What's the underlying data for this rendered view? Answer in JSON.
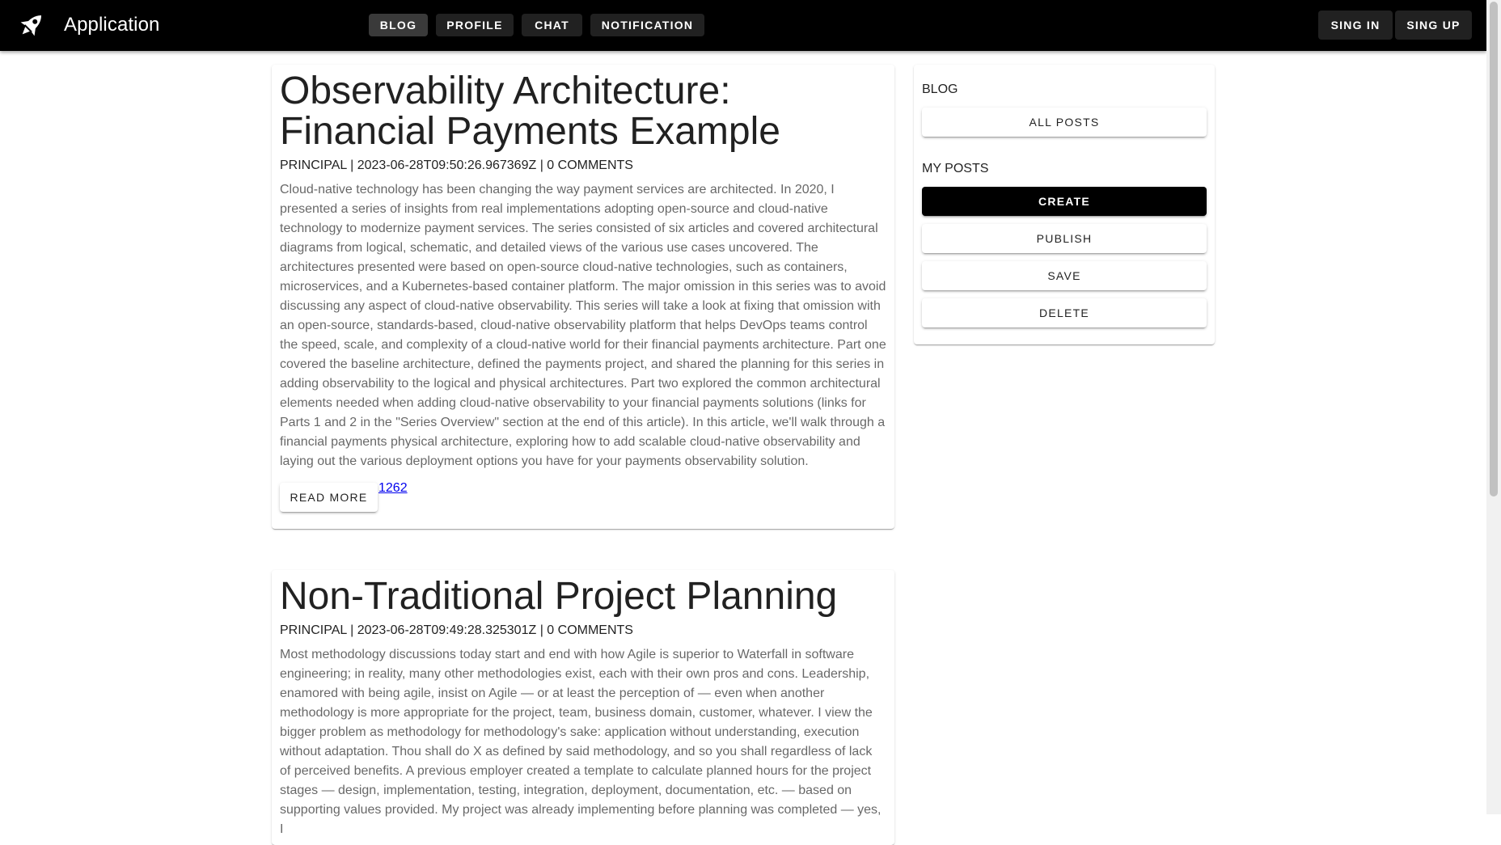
{
  "app": {
    "title": "Application"
  },
  "nav": {
    "items": [
      {
        "label": "BLOG",
        "active": true
      },
      {
        "label": "PROFILE",
        "active": false
      },
      {
        "label": "CHAT",
        "active": false
      },
      {
        "label": "NOTIFICATION",
        "active": false
      }
    ],
    "sign_in": "SING IN",
    "sign_up": "SING UP"
  },
  "posts": [
    {
      "title": "Observability Architecture: Financial Payments Example",
      "meta": "PRINCIPAL | 2023-06-28T09:50:26.967369Z | 0 COMMENTS",
      "body": "Cloud-native technology has been changing the way payment services are architected. In 2020, I presented a series of insights from real implementations adopting open-source and cloud-native technology to modernize payment services. The series consisted of six articles and covered architectural diagrams from logical, schematic, and detailed views of the various use cases uncovered. The architectures presented were based on open-source cloud-native technologies, such as containers, microservices, and a Kubernetes-based container platform. The major omission in this series was to avoid discussing any aspect of cloud-native observability. This series will take a look at fixing that omission with an open-source, standards-based, cloud-native observability platform that helps DevOps teams control the speed, scale, and complexity of a cloud-native world for their financial payments architecture. Part one covered the baseline architecture, defined the payments project, and shared the planning for this series in adding observability to the logical and physical architectures. Part two explored the common architectural elements needed when adding cloud-native observability to your financial payments solutions (links for Parts 1 and 2 in the \"Series Overview\" section at the end of this article). In this article, we'll walk through a financial payments physical architecture, exploring how to add scalable cloud-native observability and laying out the various deployment options you have for your payments observability solution.",
      "read_more": "READ MORE",
      "link": "1262"
    },
    {
      "title": "Non-Traditional Project Planning",
      "meta": "PRINCIPAL | 2023-06-28T09:49:28.325301Z | 0 COMMENTS",
      "body": "Most methodology discussions today start and end with how Agile is superior to Waterfall in software engineering; in reality, many other methodologies exist, each with their own pros and cons. Leadership, enamored with being agile, insist on Agile — or at least the perception of — even when another methodology is more appropriate for the project, team, business domain, customer, whatever. I view the bigger problem as methodology for methodology's sake: application without understanding, execution without adaptation. Thou shall do X as defined by said methodology, and so you shall regardless of lack of perceived benefits. A previous employer created a template to calculate planned hours for the project stages — design, implementation, testing, integration, deployment, documentation, etc. — based on supporting values provided. My project was already implementing before planning was completed — yes, I"
    }
  ],
  "sidebar": {
    "blog_label": "BLOG",
    "all_posts": "ALL POSTS",
    "my_posts_label": "MY POSTS",
    "create": "CREATE",
    "publish": "PUBLISH",
    "save": "SAVE",
    "delete": "DELETE"
  },
  "icons": {
    "logo": "rocket-icon"
  },
  "colors": {
    "appbar": "#000000",
    "nav_button": "#212121",
    "primary_button": "#000000",
    "link": "#0000ee"
  }
}
